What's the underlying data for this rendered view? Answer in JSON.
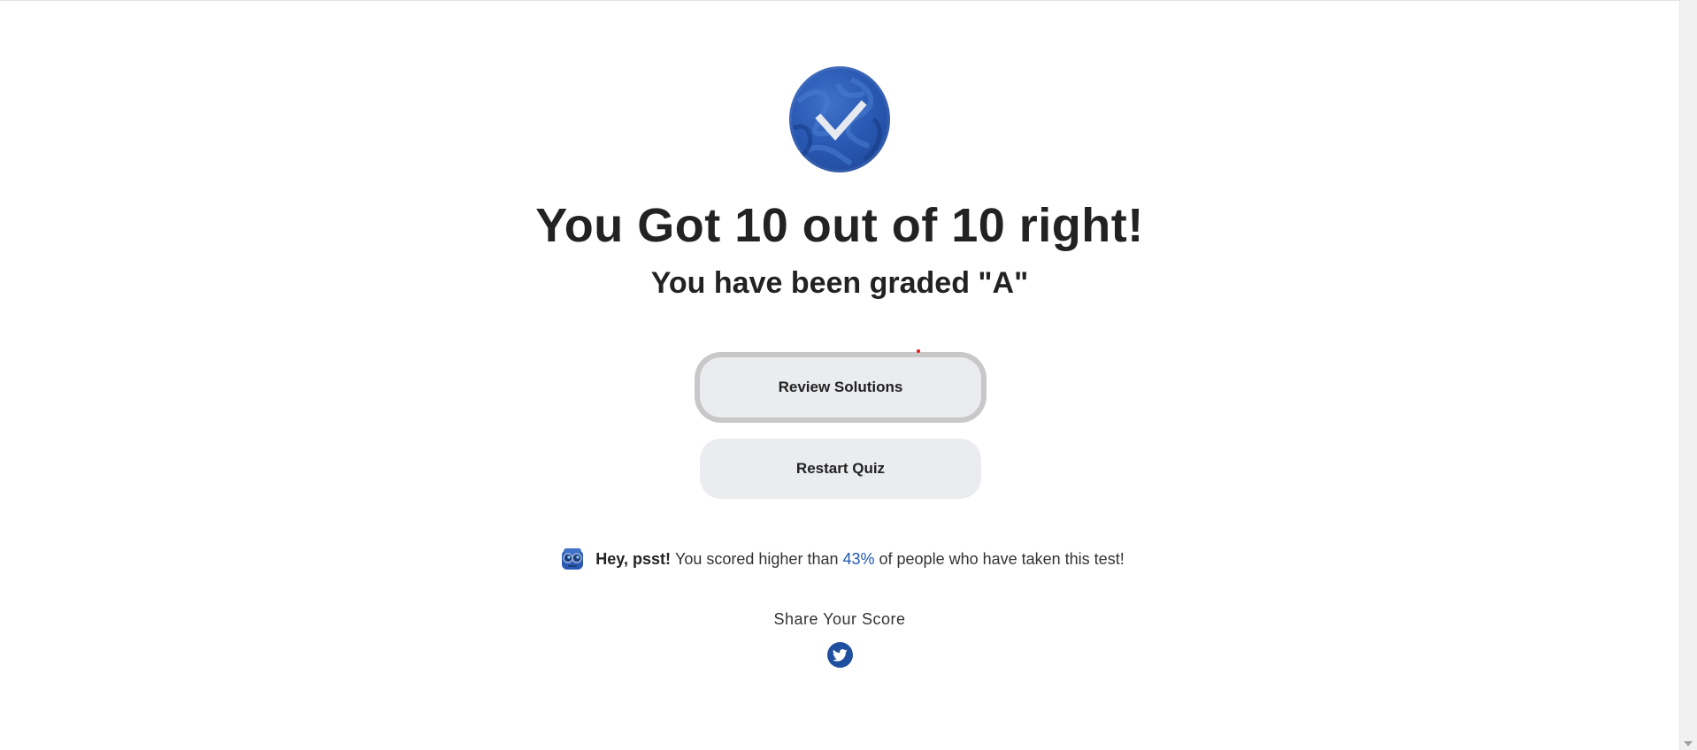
{
  "result": {
    "headline": "You Got 10 out of 10 right!",
    "grade_text": "You have been graded \"A\""
  },
  "actions": {
    "review_label": "Review Solutions",
    "restart_label": "Restart Quiz"
  },
  "notice": {
    "lead": "Hey, psst!",
    "text_before": "You scored higher than",
    "percentile": "43%",
    "text_after": "of people who have taken this test!"
  },
  "share": {
    "title": "Share Your Score",
    "networks": [
      "twitter-icon"
    ]
  },
  "colors": {
    "accent": "#1f58b0",
    "badge": "#2a59b3",
    "button_bg": "#ebecef",
    "focus_ring": "#c8c8c8"
  },
  "icons": {
    "badge": "check-badge-icon",
    "notice": "robot-icon",
    "share": "twitter-icon"
  }
}
